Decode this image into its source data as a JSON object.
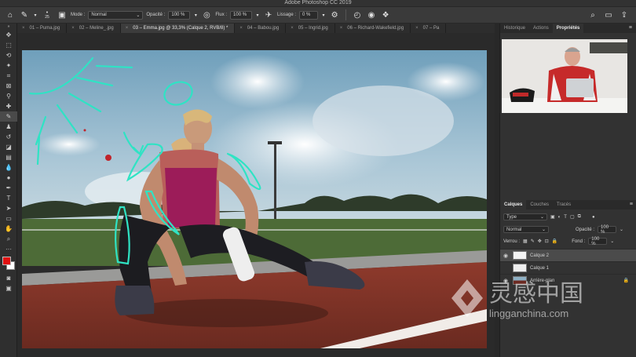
{
  "window": {
    "title": "Adobe Photoshop CC 2019"
  },
  "options": {
    "brush_size": "25",
    "mode_label": "Mode :",
    "mode_value": "Normal",
    "opacity_label": "Opacité :",
    "opacity_value": "100 %",
    "flow_label": "Flux :",
    "flow_value": "100 %",
    "smoothing_label": "Lissage :",
    "smoothing_value": "0 %"
  },
  "tabs": [
    {
      "label": "01 – Puma.jpg"
    },
    {
      "label": "02 – Meline_.jpg"
    },
    {
      "label": "03 – Emma.jpg @ 33,3% (Calque 2, RVB/8) *",
      "active": true
    },
    {
      "label": "04 – Babou.jpg"
    },
    {
      "label": "05 – Ingrid.jpg"
    },
    {
      "label": "06 – Richard-Wakefield.jpg"
    },
    {
      "label": "07 – Pa"
    }
  ],
  "panels": {
    "top_tabs": [
      "Historique",
      "Actions",
      "Propriétés"
    ],
    "layers_tabs": [
      "Calques",
      "Couches",
      "Tracés"
    ],
    "filter_type": "Type",
    "blend_mode": "Normal",
    "opacity_label": "Opacité :",
    "opacity_value": "100 %",
    "lock_label": "Verrou :",
    "fill_label": "Fond :",
    "fill_value": "100 %"
  },
  "layers": [
    {
      "name": "Calque 2",
      "selected": true
    },
    {
      "name": "Calque 1"
    },
    {
      "name": "Arrière-plan"
    }
  ],
  "watermark": {
    "brand": "灵感中国",
    "url": "lingganchina.com"
  },
  "colors": {
    "accent_stroke": "#2fe3c4",
    "foreground": "#e01010",
    "background": "#ffffff"
  }
}
